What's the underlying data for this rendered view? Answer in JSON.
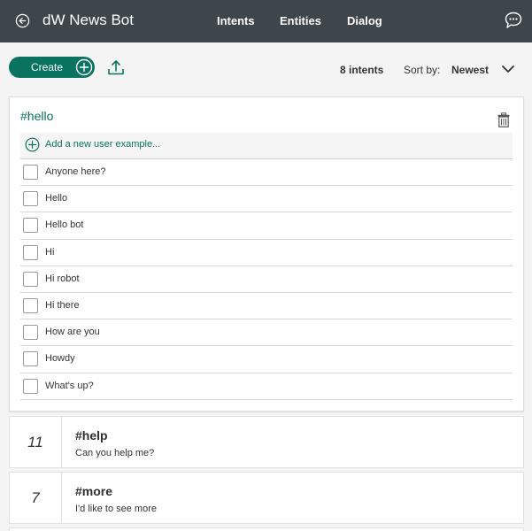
{
  "header": {
    "title": "dW News Bot",
    "nav": [
      "Intents",
      "Entities",
      "Dialog"
    ]
  },
  "toolbar": {
    "create_label": "Create",
    "intent_count": "8 intents",
    "sort_label": "Sort by:",
    "sort_value": "Newest"
  },
  "expanded_intent": {
    "name": "#hello",
    "add_example_label": "Add a new user example...",
    "examples": [
      "Anyone here?",
      "Hello",
      "Hello bot",
      "Hi",
      "Hi robot",
      "Hi there",
      "How are you",
      "Howdy",
      "What's up?"
    ]
  },
  "intents": [
    {
      "count": "11",
      "name": "#help",
      "example": "Can you help me?"
    },
    {
      "count": "7",
      "name": "#more",
      "example": "I'd like to see more"
    }
  ],
  "colors": {
    "header_bg": "#3f464b",
    "accent": "#0a7360",
    "page_bg": "#f4f4f4"
  }
}
